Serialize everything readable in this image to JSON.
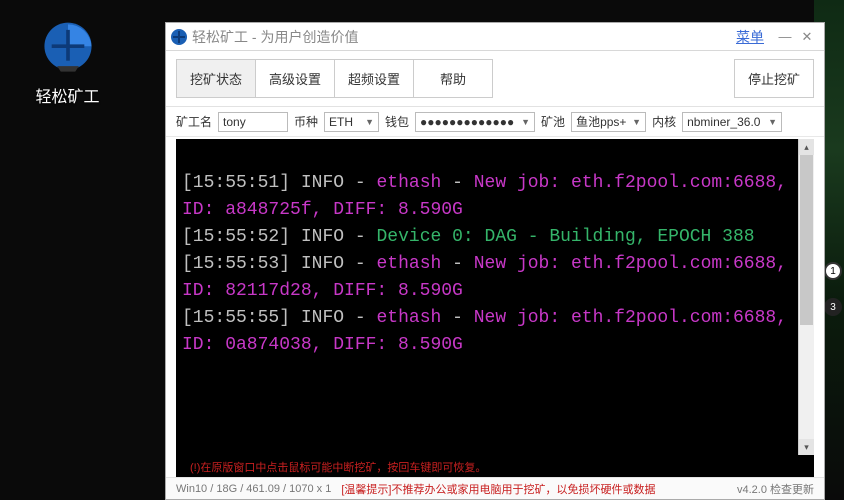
{
  "desktop": {
    "icon_label": "轻松矿工"
  },
  "window": {
    "title": "轻松矿工 - 为用户创造价值",
    "menu_label": "菜单"
  },
  "tabs": {
    "mining_status": "挖矿状态",
    "advanced": "高级设置",
    "overclock": "超频设置",
    "help": "帮助",
    "stop_mining": "停止挖矿"
  },
  "fields": {
    "worker_label": "矿工名",
    "worker_value": "tony",
    "coin_label": "币种",
    "coin_value": "ETH",
    "wallet_label": "钱包",
    "wallet_value": "●●●●●●●●●●●●●",
    "pool_label": "矿池",
    "pool_value": "鱼池pps+",
    "kernel_label": "内核",
    "kernel_value": "nbminer_36.0"
  },
  "console": {
    "lines": [
      {
        "ts": "[15:55:51]",
        "lvl": "INFO",
        "tag": "ethash",
        "rest_mag": "New job: eth.f2pool.com:6688, ID: a848725f, DIFF: 8.590G"
      },
      {
        "ts": "[15:55:52]",
        "lvl": "INFO",
        "tag_grn": "Device 0: DAG - Building, EPOCH 388"
      },
      {
        "ts": "[15:55:53]",
        "lvl": "INFO",
        "tag": "ethash",
        "rest_mag": "New job: eth.f2pool.com:6688, ID: 82117d28, DIFF: 8.590G"
      },
      {
        "ts": "[15:55:55]",
        "lvl": "INFO",
        "tag": "ethash",
        "rest_mag": "New job: eth.f2pool.com:6688, ID: 0a874038, DIFF: 8.590G"
      }
    ],
    "hint": "(!)在原版窗口中点击鼠标可能中断挖矿，按回车键即可恢复。"
  },
  "status": {
    "sys": "Win10 / 18G / 461.09 / 1070 x 1",
    "warn": "[温馨提示]不推荐办公或家用电脑用于挖矿，以免损坏硬件或数据",
    "version": "v4.2.0 检查更新"
  }
}
